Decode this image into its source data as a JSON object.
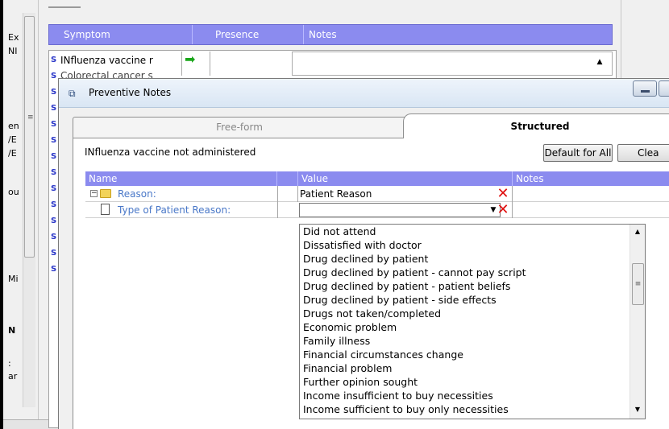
{
  "background_app": {
    "left_strip_labels": [
      "Ex",
      "NI",
      "en",
      "/E",
      "/E",
      "ou",
      "Mi",
      "N",
      ":",
      "ar"
    ],
    "grid_columns": [
      "Symptom",
      "Presence",
      "Notes"
    ],
    "row1_text": "INfluenza vaccine r",
    "row2_text": "Colorectal cancer s",
    "s_icon": "S"
  },
  "dialog": {
    "title": "Preventive Notes",
    "tabs": [
      {
        "label": "Free-form",
        "selected": false
      },
      {
        "label": "Structured",
        "selected": true
      }
    ],
    "subject": "INfluenza vaccine not administered",
    "buttons": {
      "default_all": "Default for All",
      "clear": "Clea"
    },
    "grid": {
      "columns": [
        "Name",
        "Value",
        "Notes"
      ],
      "rows": [
        {
          "name": "Reason:",
          "value": "Patient Reason",
          "icon": "folder-icon"
        },
        {
          "name": "Type of Patient Reason:",
          "value": "",
          "icon": "document-icon"
        }
      ]
    },
    "dropdown_options": [
      "Did not attend",
      "Dissatisfied with doctor",
      "Drug declined by patient",
      "Drug declined by patient - cannot pay script",
      "Drug declined by patient - patient beliefs",
      "Drug declined by patient - side effects",
      "Drugs not taken/completed",
      "Economic problem",
      "Family illness",
      "Financial circumstances change",
      "Financial problem",
      "Further opinion sought",
      "Income insufficient to buy necessities",
      "Income sufficient to buy only necessities"
    ]
  },
  "colors": {
    "grid_header": "#8b8bef",
    "link_text": "#4a78c8",
    "delete_x": "#e01010",
    "arrow_green": "#1aa61a"
  }
}
